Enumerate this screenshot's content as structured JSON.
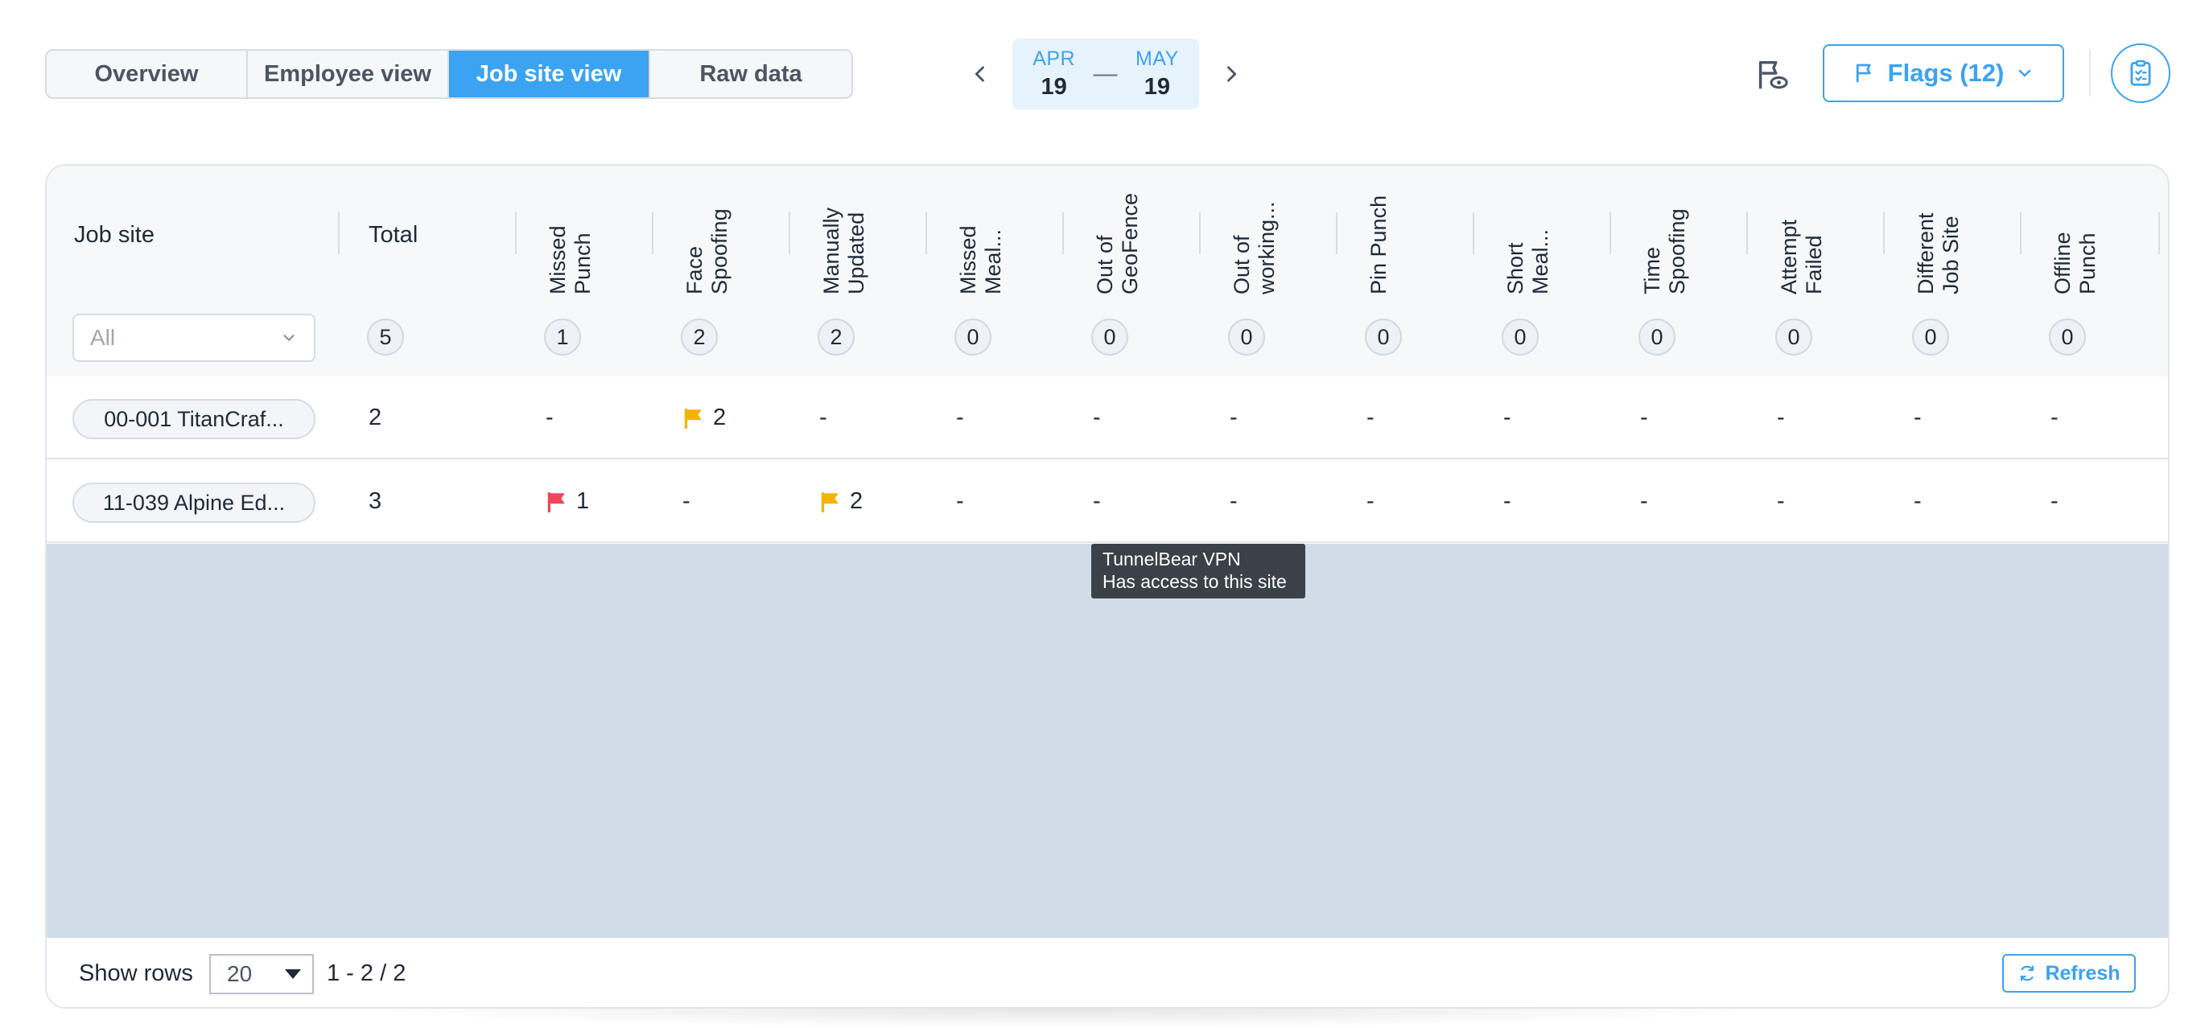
{
  "tabs": [
    {
      "label": "Overview",
      "active": false
    },
    {
      "label": "Employee view",
      "active": false
    },
    {
      "label": "Job site view",
      "active": true
    },
    {
      "label": "Raw data",
      "active": false
    }
  ],
  "date_range": {
    "start_month": "APR",
    "start_day": "19",
    "separator": "—",
    "end_month": "MAY",
    "end_day": "19"
  },
  "flags_button": {
    "label": "Flags (12)"
  },
  "table": {
    "col_jobsite": "Job site",
    "col_total": "Total",
    "filter_value": "All",
    "total_count": "5",
    "flag_columns": [
      {
        "label": "Missed Punch",
        "count": "1"
      },
      {
        "label": "Face Spoofing",
        "count": "2"
      },
      {
        "label": "Manually Updated",
        "count": "2"
      },
      {
        "label": "Missed Meal...",
        "count": "0"
      },
      {
        "label": "Out of GeoFence",
        "count": "0"
      },
      {
        "label": "Out of working...",
        "count": "0"
      },
      {
        "label": "Pin Punch",
        "count": "0"
      },
      {
        "label": "Short Meal...",
        "count": "0"
      },
      {
        "label": "Time Spoofing",
        "count": "0"
      },
      {
        "label": "Attempt Failed",
        "count": "0"
      },
      {
        "label": "Different Job Site",
        "count": "0"
      },
      {
        "label": "Offline Punch",
        "count": "0"
      }
    ],
    "rows": [
      {
        "site": "00-001 TitanCraf...",
        "total": "2",
        "cells": [
          {
            "value": "-",
            "flag": ""
          },
          {
            "value": "2",
            "flag": "#f5b301"
          },
          {
            "value": "-",
            "flag": ""
          },
          {
            "value": "-",
            "flag": ""
          },
          {
            "value": "-",
            "flag": ""
          },
          {
            "value": "-",
            "flag": ""
          },
          {
            "value": "-",
            "flag": ""
          },
          {
            "value": "-",
            "flag": ""
          },
          {
            "value": "-",
            "flag": ""
          },
          {
            "value": "-",
            "flag": ""
          },
          {
            "value": "-",
            "flag": ""
          },
          {
            "value": "-",
            "flag": ""
          }
        ]
      },
      {
        "site": "11-039 Alpine Ed...",
        "total": "3",
        "cells": [
          {
            "value": "1",
            "flag": "#f0445a"
          },
          {
            "value": "-",
            "flag": ""
          },
          {
            "value": "2",
            "flag": "#f5b301"
          },
          {
            "value": "-",
            "flag": ""
          },
          {
            "value": "-",
            "flag": ""
          },
          {
            "value": "-",
            "flag": ""
          },
          {
            "value": "-",
            "flag": ""
          },
          {
            "value": "-",
            "flag": ""
          },
          {
            "value": "-",
            "flag": ""
          },
          {
            "value": "-",
            "flag": ""
          },
          {
            "value": "-",
            "flag": ""
          },
          {
            "value": "-",
            "flag": ""
          }
        ]
      }
    ]
  },
  "tooltip": {
    "line1": "TunnelBear VPN",
    "line2": "Has access to this site"
  },
  "footer": {
    "rows_label": "Show rows",
    "rows_value": "20",
    "range": "1 - 2 / 2",
    "refresh_label": "Refresh"
  },
  "colors": {
    "accent": "#3ba3f1",
    "flag_red": "#f0445a",
    "flag_yellow": "#f5b301"
  }
}
